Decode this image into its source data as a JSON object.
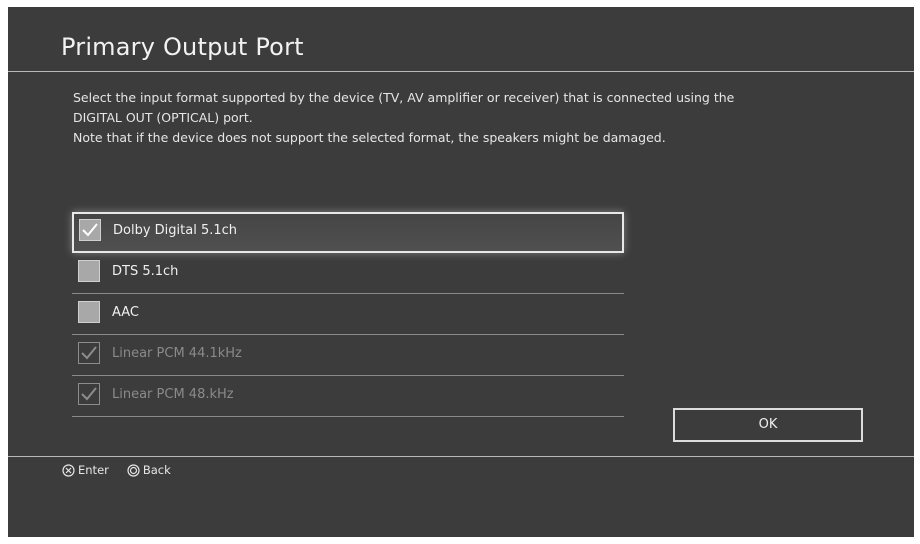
{
  "dialog": {
    "title": "Primary Output Port",
    "description_lines": [
      "Select the input format supported by the device (TV, AV amplifier or receiver) that is connected using the",
      "DIGITAL OUT (OPTICAL) port.",
      "Note that if the device does not support the selected format, the speakers might be damaged."
    ]
  },
  "options": [
    {
      "label": "Dolby Digital 5.1ch",
      "checked": true,
      "enabled": true,
      "focused": true
    },
    {
      "label": "DTS 5.1ch",
      "checked": false,
      "enabled": true,
      "focused": false
    },
    {
      "label": "AAC",
      "checked": false,
      "enabled": true,
      "focused": false
    },
    {
      "label": "Linear PCM 44.1kHz",
      "checked": true,
      "enabled": false,
      "focused": false
    },
    {
      "label": "Linear PCM 48.kHz",
      "checked": true,
      "enabled": false,
      "focused": false
    }
  ],
  "ok_button": {
    "label": "OK"
  },
  "footer": {
    "enter_label": "Enter",
    "back_label": "Back",
    "enter_icon": "cross-button-icon",
    "back_icon": "circle-button-icon"
  },
  "colors": {
    "background": "#3c3c3c",
    "text": "#f0f0f0",
    "disabled_text": "#8a8a8a"
  }
}
